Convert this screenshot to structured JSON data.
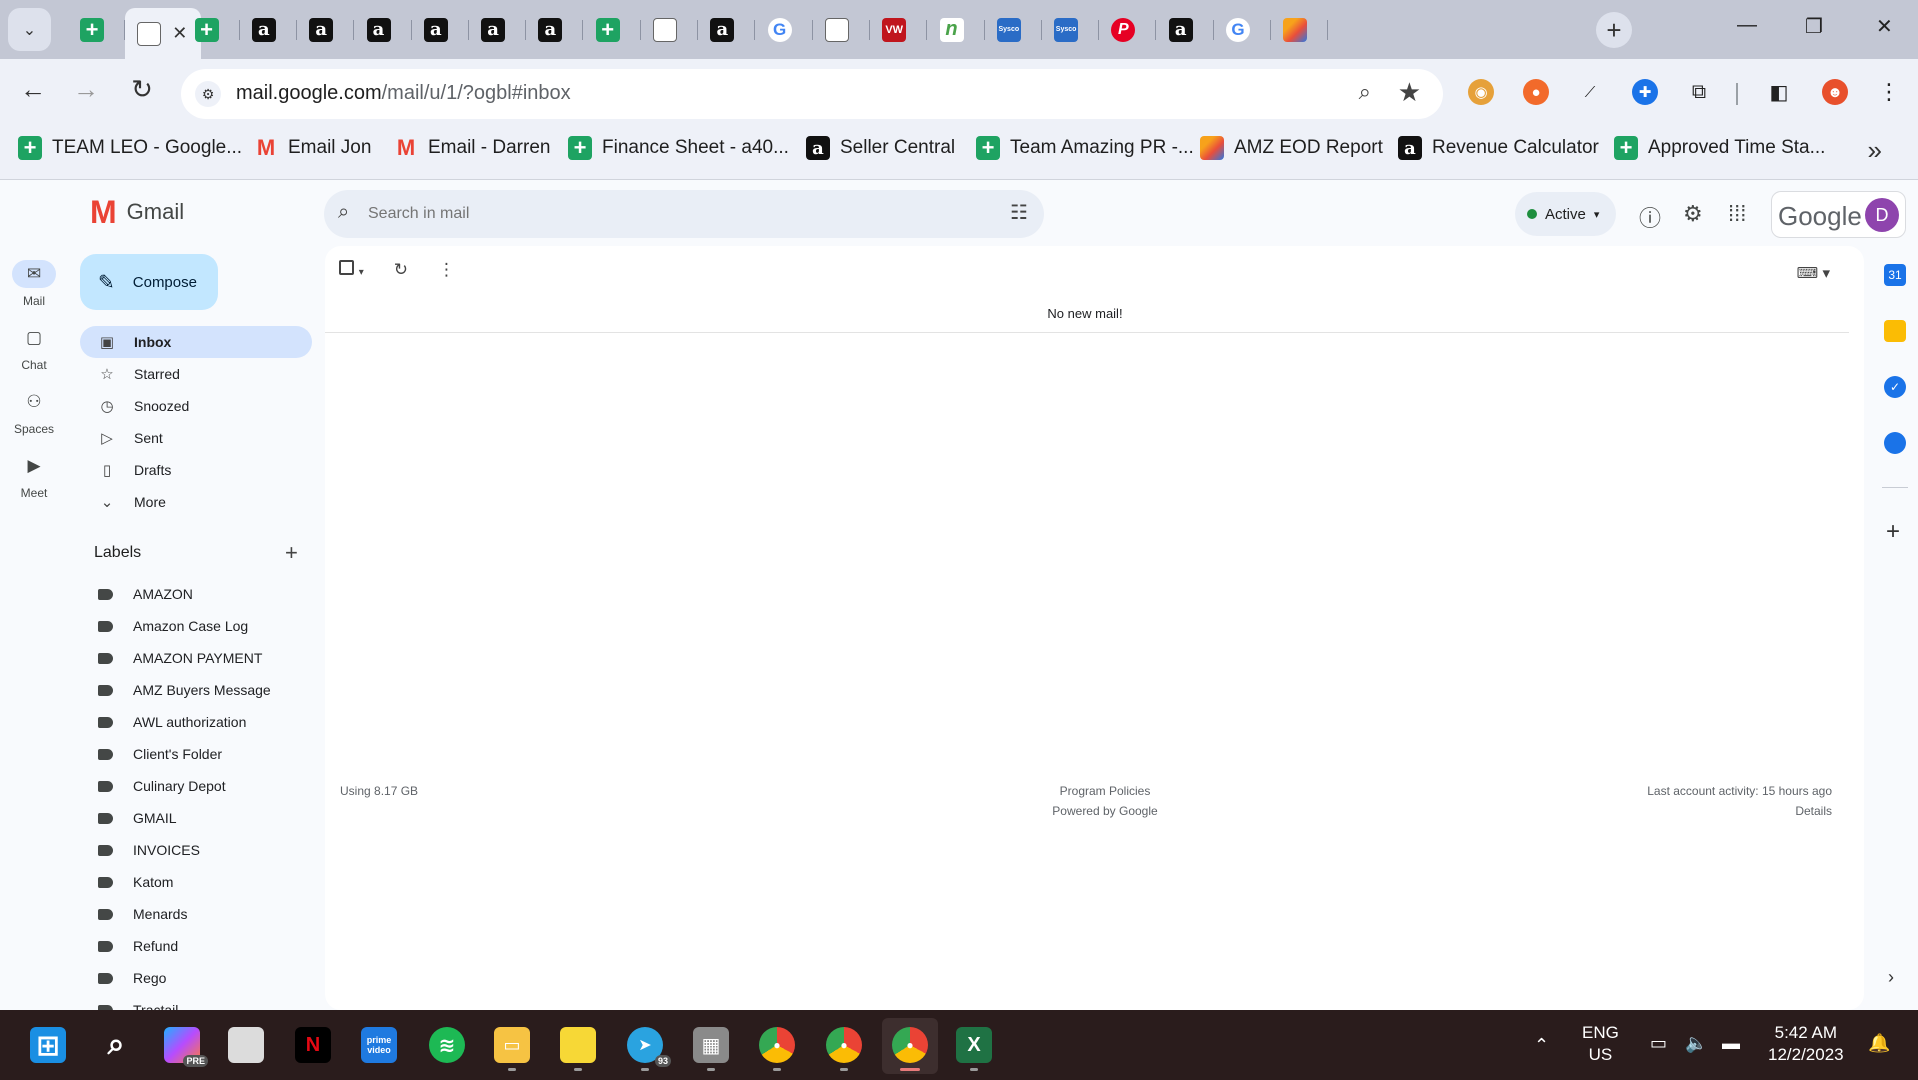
{
  "browser": {
    "tabs": [
      {
        "icon": "sheets-icon",
        "label": "+"
      },
      {
        "icon": "blank-icon",
        "label": "",
        "active": true
      },
      {
        "icon": "sheets-icon",
        "label": "+"
      },
      {
        "icon": "amazon-icon",
        "label": "a"
      },
      {
        "icon": "amazon-icon",
        "label": "a"
      },
      {
        "icon": "amazon-icon",
        "label": "a"
      },
      {
        "icon": "amazon-icon",
        "label": "a"
      },
      {
        "icon": "amazon-icon",
        "label": "a"
      },
      {
        "icon": "amazon-icon",
        "label": "a"
      },
      {
        "icon": "sheets-icon",
        "label": "+"
      },
      {
        "icon": "document-icon",
        "label": ""
      },
      {
        "icon": "amazon-icon",
        "label": "a"
      },
      {
        "icon": "google-icon",
        "label": "G"
      },
      {
        "icon": "document-icon",
        "label": ""
      },
      {
        "icon": "vw-icon",
        "label": "VW"
      },
      {
        "icon": "n-icon",
        "label": "n"
      },
      {
        "icon": "sysco-icon",
        "label": "Sysco"
      },
      {
        "icon": "sysco-icon",
        "label": "Sysco"
      },
      {
        "icon": "pinterest-icon",
        "label": "P"
      },
      {
        "icon": "amazon-icon",
        "label": "a"
      },
      {
        "icon": "google-icon",
        "label": "G"
      },
      {
        "icon": "multicolor-app-icon",
        "label": ""
      }
    ],
    "url_host": "mail.google.com",
    "url_path": "/mail/u/1/?ogbl#inbox",
    "bookmarks": [
      {
        "icon": "sheets-icon",
        "glyph": "+",
        "label": "TEAM LEO - Google..."
      },
      {
        "icon": "gmail-icon",
        "glyph": "M",
        "label": "Email Jon"
      },
      {
        "icon": "gmail-icon",
        "glyph": "M",
        "label": "Email - Darren"
      },
      {
        "icon": "sheets-icon",
        "glyph": "+",
        "label": "Finance Sheet - a40..."
      },
      {
        "icon": "amazon-icon",
        "glyph": "a",
        "label": "Seller Central"
      },
      {
        "icon": "sheets-icon",
        "glyph": "+",
        "label": "Team Amazing PR -..."
      },
      {
        "icon": "multicolor-app-icon",
        "glyph": "",
        "label": "AMZ EOD Report"
      },
      {
        "icon": "amazon-icon",
        "glyph": "a",
        "label": "Revenue Calculator"
      },
      {
        "icon": "sheets-icon",
        "glyph": "+",
        "label": "Approved Time Sta..."
      }
    ]
  },
  "gmail": {
    "app_name": "Gmail",
    "rail": [
      {
        "icon": "mail-icon",
        "label": "Mail",
        "active": true
      },
      {
        "icon": "chat-icon",
        "label": "Chat"
      },
      {
        "icon": "spaces-icon",
        "label": "Spaces"
      },
      {
        "icon": "meet-icon",
        "label": "Meet"
      }
    ],
    "search_placeholder": "Search in mail",
    "status": "Active",
    "google_word": "Google",
    "avatar_letter": "D",
    "compose_label": "Compose",
    "nav": [
      {
        "icon": "inbox-icon",
        "label": "Inbox",
        "active": true
      },
      {
        "icon": "star-icon",
        "label": "Starred"
      },
      {
        "icon": "clock-icon",
        "label": "Snoozed"
      },
      {
        "icon": "send-icon",
        "label": "Sent"
      },
      {
        "icon": "draft-icon",
        "label": "Drafts"
      },
      {
        "icon": "chevron-down-icon",
        "label": "More"
      }
    ],
    "labels_heading": "Labels",
    "labels": [
      "AMAZON",
      "Amazon Case Log",
      "AMAZON PAYMENT",
      "AMZ Buyers Message",
      "AWL authorization",
      "Client's Folder",
      "Culinary Depot",
      "GMAIL",
      "INVOICES",
      "Katom",
      "Menards",
      "Refund",
      "Rego",
      "Tractail..."
    ],
    "empty_message": "No new mail!",
    "storage_text": "Using 8.17 GB",
    "program_policies": "Program Policies",
    "powered_by": "Powered by Google",
    "last_activity": "Last account activity: 15 hours ago",
    "details_link": "Details"
  },
  "side_panel": [
    {
      "icon": "calendar-icon",
      "label": "31"
    },
    {
      "icon": "keep-icon",
      "label": ""
    },
    {
      "icon": "tasks-icon",
      "label": "✓"
    },
    {
      "icon": "contacts-icon",
      "label": ""
    }
  ],
  "taskbar": {
    "apps": [
      {
        "icon": "windows-start-icon"
      },
      {
        "icon": "search-icon"
      },
      {
        "icon": "copilot-pre-icon",
        "badge": "PRE"
      },
      {
        "icon": "task-view-icon"
      },
      {
        "icon": "netflix-icon",
        "label": "N"
      },
      {
        "icon": "prime-video-icon",
        "label": "prime video"
      },
      {
        "icon": "spotify-icon"
      },
      {
        "icon": "file-explorer-icon"
      },
      {
        "icon": "sticky-notes-icon"
      },
      {
        "icon": "telegram-icon",
        "badge": "93"
      },
      {
        "icon": "calculator-icon"
      },
      {
        "icon": "chrome-icon"
      },
      {
        "icon": "chrome-icon"
      },
      {
        "icon": "chrome-icon",
        "active": true
      },
      {
        "icon": "excel-icon",
        "label": "X"
      }
    ],
    "lang_top": "ENG",
    "lang_bottom": "US",
    "time": "5:42 AM",
    "date": "12/2/2023"
  },
  "colors": {
    "tab_strip": "#c3c7d4",
    "toolbar": "#eef1f8",
    "gmail_bg": "#f8fafd",
    "compose_bg": "#c2e7ff",
    "selected_nav": "#d3e3fd",
    "taskbar": "#2a1c1c",
    "avatar": "#8e44ad"
  }
}
